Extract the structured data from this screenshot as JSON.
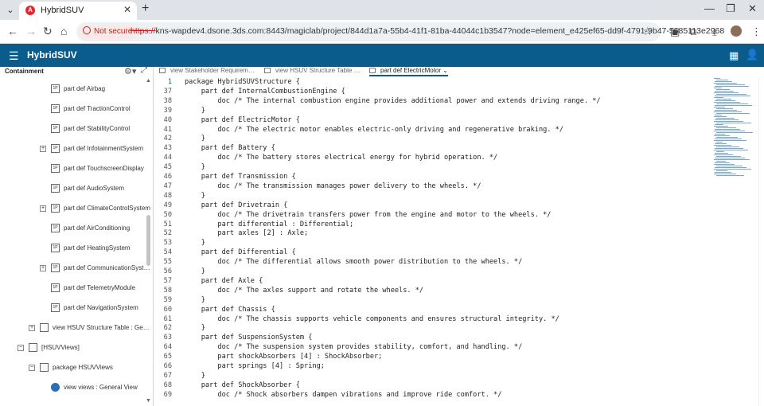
{
  "browser": {
    "tab_title": "HybridSUV",
    "tab_favicon": "A",
    "not_secure_label": "Not secure",
    "url_scheme": "https://",
    "url_rest": "kns-wapdev4.dsone.3ds.com:8443/magiclab/project/844d1a7a-55b4-41f1-81ba-44044c1b3547?node=element_e425ef65-dd9f-4791-9b47-5685113e2968"
  },
  "app": {
    "title": "HybridSUV"
  },
  "left_panel": {
    "title": "Containment",
    "tree": [
      {
        "label": "part def Airbag",
        "level": 2,
        "expand": false,
        "icon": "part-def-icon"
      },
      {
        "label": "part def TractionControl",
        "level": 2,
        "expand": false,
        "icon": "part-def-icon"
      },
      {
        "label": "part def StabilityControl",
        "level": 2,
        "expand": false,
        "icon": "part-def-icon"
      },
      {
        "label": "part def InfotainmentSystem",
        "level": 2,
        "expand": true,
        "icon": "part-def-icon"
      },
      {
        "label": "part def TouchscreenDisplay",
        "level": 2,
        "expand": false,
        "icon": "part-def-icon"
      },
      {
        "label": "part def AudioSystem",
        "level": 2,
        "expand": false,
        "icon": "part-def-icon"
      },
      {
        "label": "part def ClimateControlSystem",
        "level": 2,
        "expand": true,
        "icon": "part-def-icon"
      },
      {
        "label": "part def AirConditioning",
        "level": 2,
        "expand": false,
        "icon": "part-def-icon"
      },
      {
        "label": "part def HeatingSystem",
        "level": 2,
        "expand": false,
        "icon": "part-def-icon"
      },
      {
        "label": "part def CommunicationSyst…",
        "level": 2,
        "expand": true,
        "icon": "part-def-icon"
      },
      {
        "label": "part def TelemetryModule",
        "level": 2,
        "expand": false,
        "icon": "part-def-icon"
      },
      {
        "label": "part def NavigationSystem",
        "level": 2,
        "expand": false,
        "icon": "part-def-icon"
      },
      {
        "label": "view HSUV Structure Table : Ge…",
        "level": 1,
        "expand": true,
        "icon": "view-icon"
      },
      {
        "label": "[HSUVViews]",
        "level": 0,
        "expand": "minus",
        "icon": "namespace-icon"
      },
      {
        "label": "package HSUVViews",
        "level": 1,
        "expand": "minus",
        "icon": "package-icon"
      },
      {
        "label": "view views : General View",
        "level": 2,
        "expand": false,
        "icon": "general-view-icon"
      }
    ]
  },
  "editor_tabs": [
    {
      "label": "view Stakeholder Requirem…",
      "active": false
    },
    {
      "label": "view HSUV Structure Table …",
      "active": false
    },
    {
      "label": "part def ElectricMotor",
      "active": true
    }
  ],
  "code_lines": [
    {
      "n": "1",
      "text": "package HybridSUVStructure {"
    },
    {
      "n": "37",
      "text": "    part def InternalCombustionEngine {"
    },
    {
      "n": "38",
      "text": "        doc /* The internal combustion engine provides additional power and extends driving range. */"
    },
    {
      "n": "39",
      "text": "    }"
    },
    {
      "n": "40",
      "text": "    part def ElectricMotor {"
    },
    {
      "n": "41",
      "text": "        doc /* The electric motor enables electric-only driving and regenerative braking. */"
    },
    {
      "n": "42",
      "text": "    }"
    },
    {
      "n": "43",
      "text": "    part def Battery {"
    },
    {
      "n": "44",
      "text": "        doc /* The battery stores electrical energy for hybrid operation. */"
    },
    {
      "n": "45",
      "text": "    }"
    },
    {
      "n": "46",
      "text": "    part def Transmission {"
    },
    {
      "n": "47",
      "text": "        doc /* The transmission manages power delivery to the wheels. */"
    },
    {
      "n": "48",
      "text": "    }"
    },
    {
      "n": "49",
      "text": "    part def Drivetrain {"
    },
    {
      "n": "50",
      "text": "        doc /* The drivetrain transfers power from the engine and motor to the wheels. */"
    },
    {
      "n": "51",
      "text": "        part differential : Differential;"
    },
    {
      "n": "52",
      "text": "        part axles [2] : Axle;"
    },
    {
      "n": "53",
      "text": "    }"
    },
    {
      "n": "54",
      "text": "    part def Differential {"
    },
    {
      "n": "55",
      "text": "        doc /* The differential allows smooth power distribution to the wheels. */"
    },
    {
      "n": "56",
      "text": "    }"
    },
    {
      "n": "57",
      "text": "    part def Axle {"
    },
    {
      "n": "58",
      "text": "        doc /* The axles support and rotate the wheels. */"
    },
    {
      "n": "59",
      "text": "    }"
    },
    {
      "n": "60",
      "text": "    part def Chassis {"
    },
    {
      "n": "61",
      "text": "        doc /* The chassis supports vehicle components and ensures structural integrity. */"
    },
    {
      "n": "62",
      "text": "    }"
    },
    {
      "n": "63",
      "text": "    part def SuspensionSystem {"
    },
    {
      "n": "64",
      "text": "        doc /* The suspension system provides stability, comfort, and handling. */"
    },
    {
      "n": "65",
      "text": "        part shockAbsorbers [4] : ShockAbsorber;"
    },
    {
      "n": "66",
      "text": "        part springs [4] : Spring;"
    },
    {
      "n": "67",
      "text": "    }"
    },
    {
      "n": "68",
      "text": "    part def ShockAbsorber {"
    },
    {
      "n": "69",
      "text": "        doc /* Shock absorbers dampen vibrations and improve ride comfort. */"
    }
  ],
  "colors": {
    "app_bar": "#0a5c8c",
    "not_secure": "#c5221f"
  }
}
